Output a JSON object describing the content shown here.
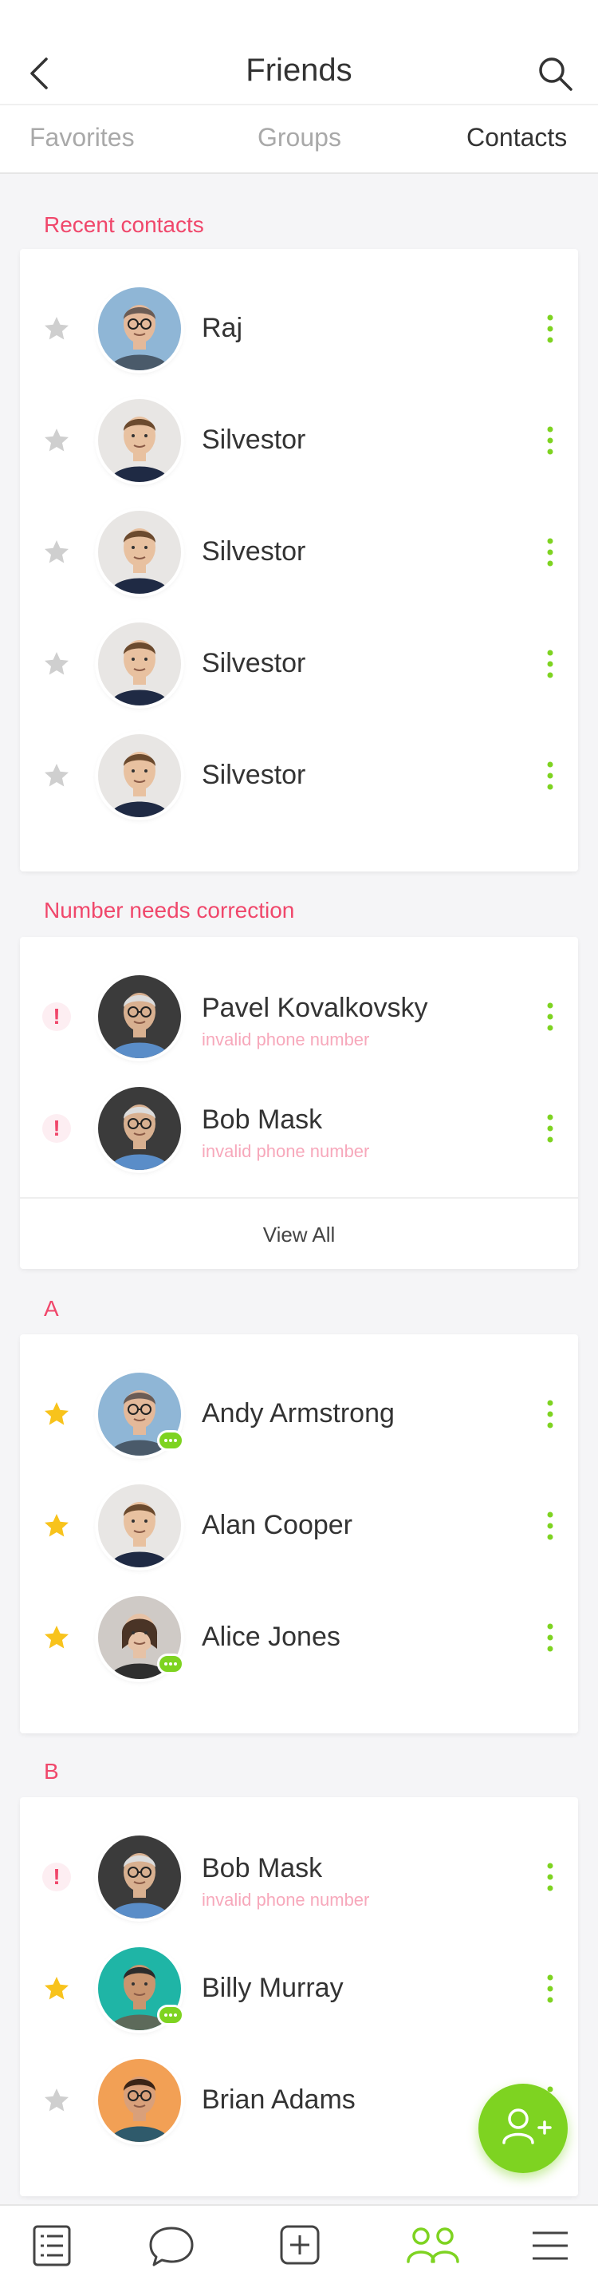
{
  "header": {
    "title": "Friends",
    "back_icon": "chevron-left-icon",
    "search_icon": "search-icon"
  },
  "tabs": [
    {
      "label": "Favorites",
      "active": false
    },
    {
      "label": "Groups",
      "active": false
    },
    {
      "label": "Contacts",
      "active": true
    }
  ],
  "recent": {
    "label": "Recent contacts",
    "items": [
      {
        "name": "Raj",
        "lead": "star",
        "favorite": false,
        "avatar": "man-glasses-blue"
      },
      {
        "name": "Silvestor",
        "lead": "star",
        "favorite": false,
        "avatar": "man-curly"
      },
      {
        "name": "Silvestor",
        "lead": "star",
        "favorite": false,
        "avatar": "man-curly"
      },
      {
        "name": "Silvestor",
        "lead": "star",
        "favorite": false,
        "avatar": "man-curly"
      },
      {
        "name": "Silvestor",
        "lead": "star",
        "favorite": false,
        "avatar": "man-curly"
      }
    ]
  },
  "correction": {
    "label": "Number needs correction",
    "items": [
      {
        "name": "Pavel Kovalkovsky",
        "sub": "invalid phone number",
        "lead": "alert",
        "avatar": "man-glasses-dark"
      },
      {
        "name": "Bob Mask",
        "sub": "invalid phone number",
        "lead": "alert",
        "avatar": "man-glasses-dark"
      }
    ],
    "view_all": "View All"
  },
  "group_a": {
    "label": "A",
    "items": [
      {
        "name": "Andy Armstrong",
        "lead": "star",
        "favorite": true,
        "avatar": "man-glasses-blue",
        "message_badge": true
      },
      {
        "name": "Alan Cooper",
        "lead": "star",
        "favorite": true,
        "avatar": "man-curly",
        "message_badge": false
      },
      {
        "name": "Alice Jones",
        "lead": "star",
        "favorite": true,
        "avatar": "woman",
        "message_badge": true
      }
    ]
  },
  "group_b": {
    "label": "B",
    "items": [
      {
        "name": "Bob Mask",
        "sub": "invalid phone number",
        "lead": "alert",
        "avatar": "man-glasses-dark"
      },
      {
        "name": "Billy Murray",
        "lead": "star",
        "favorite": true,
        "avatar": "man-teal",
        "message_badge": true
      },
      {
        "name": "Brian Adams",
        "lead": "star",
        "favorite": false,
        "avatar": "man-orange"
      }
    ]
  },
  "fab": {
    "icon": "add-user-icon"
  },
  "bottom_nav": [
    {
      "icon": "list-icon",
      "active": false
    },
    {
      "icon": "chat-icon",
      "active": false
    },
    {
      "icon": "add-square-icon",
      "active": false
    },
    {
      "icon": "friends-icon",
      "active": true
    },
    {
      "icon": "menu-icon",
      "active": false
    }
  ],
  "colors": {
    "accent_green": "#7ed321",
    "accent_red": "#f0476b",
    "star_gold": "#f8c31c",
    "star_gray": "#cfcfcf"
  }
}
